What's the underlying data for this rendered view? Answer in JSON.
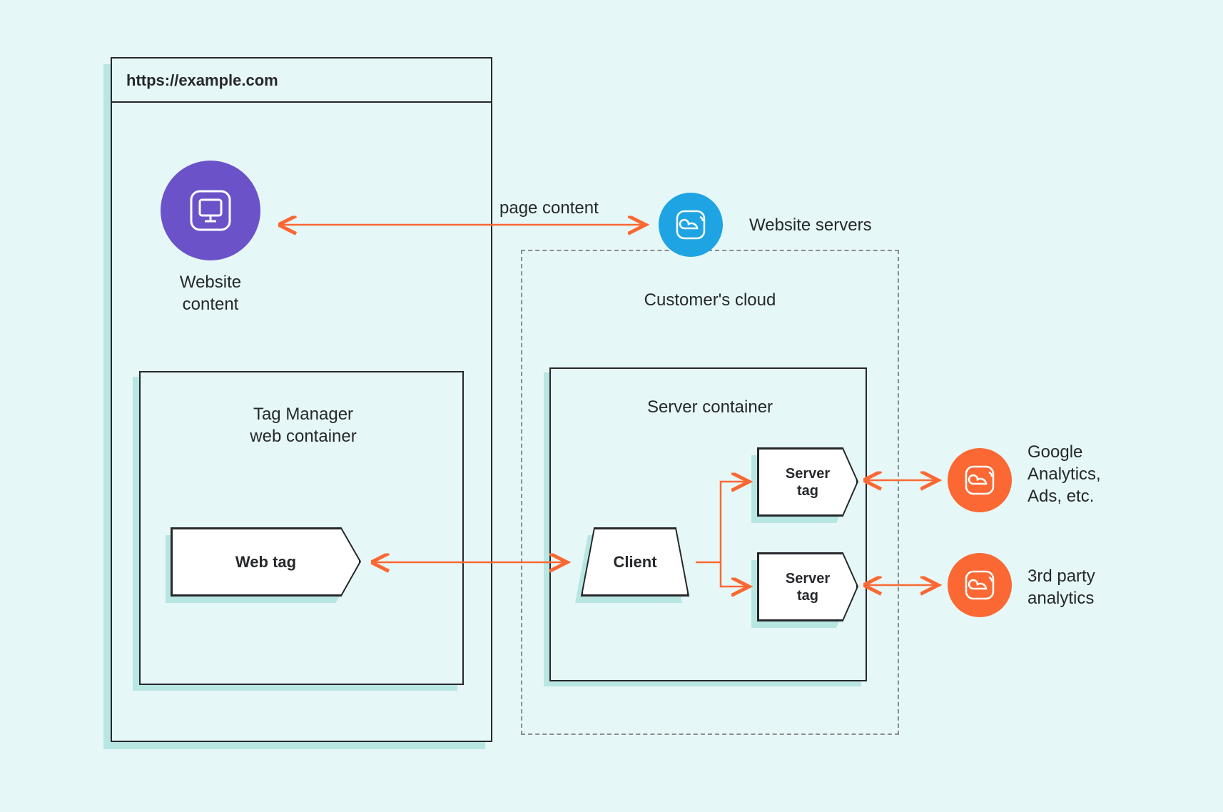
{
  "browser": {
    "url": "https://example.com"
  },
  "website_content": {
    "line1": "Website",
    "line2": "content"
  },
  "page_content_label": "page content",
  "website_servers_label": "Website servers",
  "customer_cloud_label": "Customer's cloud",
  "tag_manager": {
    "line1": "Tag Manager",
    "line2": "web container"
  },
  "web_tag_label": "Web tag",
  "server_container_label": "Server container",
  "client_label": "Client",
  "server_tag": {
    "line1": "Server",
    "line2": "tag"
  },
  "google_analytics": {
    "line1": "Google",
    "line2": "Analytics,",
    "line3": "Ads, etc."
  },
  "third_party": {
    "line1": "3rd party",
    "line2": "analytics"
  },
  "icons": {
    "monitor": "monitor-icon",
    "cloud": "cloud-icon"
  },
  "colors": {
    "bg": "#e6f7f7",
    "shadow": "#b8e6e2",
    "purple": "#6c52c9",
    "blue": "#1fa4e3",
    "orange": "#fb6833",
    "ink": "#26282b"
  }
}
